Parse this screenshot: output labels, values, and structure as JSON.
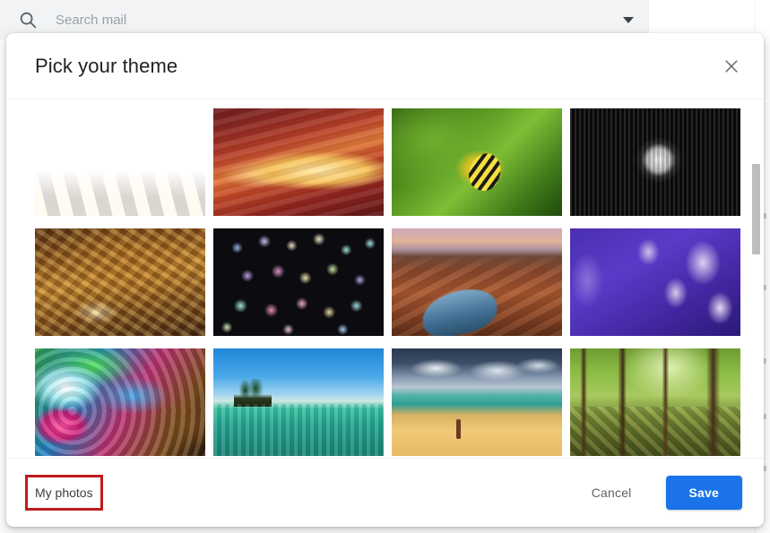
{
  "search": {
    "icon": "search-icon",
    "placeholder": "Search mail",
    "value": "",
    "options_icon": "chevron-down-icon"
  },
  "dialog": {
    "title": "Pick your theme",
    "close_icon": "close-icon",
    "footer": {
      "my_photos_label": "My photos",
      "cancel_label": "Cancel",
      "save_label": "Save"
    }
  },
  "themes": [
    {
      "name": "chess-pieces",
      "art": "art-chess"
    },
    {
      "name": "slot-canyon",
      "art": "art-canyon"
    },
    {
      "name": "caterpillar",
      "art": "art-cater"
    },
    {
      "name": "metal-pipes",
      "art": "art-pipes"
    },
    {
      "name": "autumn-leaves",
      "art": "art-leaves"
    },
    {
      "name": "colorful-bokeh",
      "art": "art-bokeh"
    },
    {
      "name": "horseshoe-bend",
      "art": "art-bend"
    },
    {
      "name": "jellyfish",
      "art": "art-jelly"
    },
    {
      "name": "water-droplet",
      "art": "art-drop"
    },
    {
      "name": "mountain-lake",
      "art": "art-lake"
    },
    {
      "name": "stormy-beach",
      "art": "art-beach"
    },
    {
      "name": "green-forest",
      "art": "art-forest"
    }
  ],
  "annotation": {
    "color": "#c01c1c",
    "target": "My photos"
  },
  "colors": {
    "accent": "#1a73e8",
    "searchbar_bg": "#f1f3f4",
    "title_text": "#202124",
    "muted_text": "#5f6368",
    "scrollbar_thumb": "#bdbdbd"
  },
  "scrollbar": {
    "orientation": "vertical",
    "thumb_position": "top"
  }
}
